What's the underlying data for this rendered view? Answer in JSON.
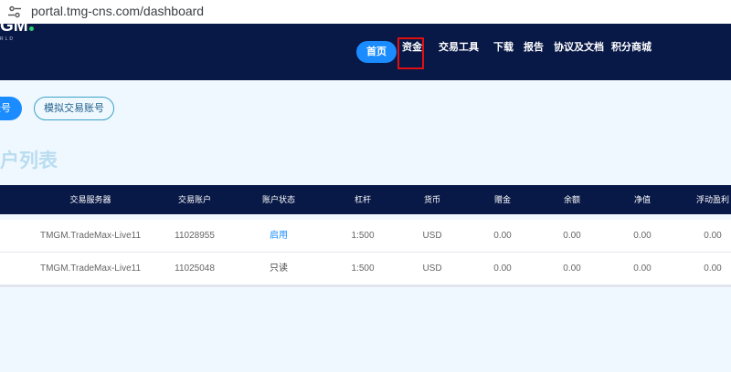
{
  "browser": {
    "url": "portal.tmg-cns.com/dashboard"
  },
  "brand": {
    "logo_text": "GM",
    "logo_sub": "RLD"
  },
  "nav": {
    "home": "首页",
    "funds": "资金",
    "trade_tools": "交易工具",
    "download": "下载",
    "reports": "报告",
    "agreements": "协议及文档",
    "points_mall": "积分商城"
  },
  "accounts_tabs": {
    "live": "账号",
    "demo": "模拟交易账号"
  },
  "section": {
    "title": "户列表"
  },
  "table": {
    "headers": [
      "交易服务器",
      "交易账户",
      "账户状态",
      "杠杆",
      "货币",
      "赠金",
      "余额",
      "净值",
      "浮动盈利"
    ],
    "rows": [
      [
        "TMGM.TradeMax-Live11",
        "11028955",
        "启用",
        "1:500",
        "USD",
        "0.00",
        "0.00",
        "0.00",
        "0.00"
      ],
      [
        "TMGM.TradeMax-Live11",
        "11025048",
        "只读",
        "1:500",
        "USD",
        "0.00",
        "0.00",
        "0.00",
        "0.00"
      ]
    ]
  },
  "colors": {
    "nav_bg": "#081847",
    "accent": "#1a8cff",
    "highlight": "#e01010",
    "page_bg": "#f0f8ff"
  }
}
